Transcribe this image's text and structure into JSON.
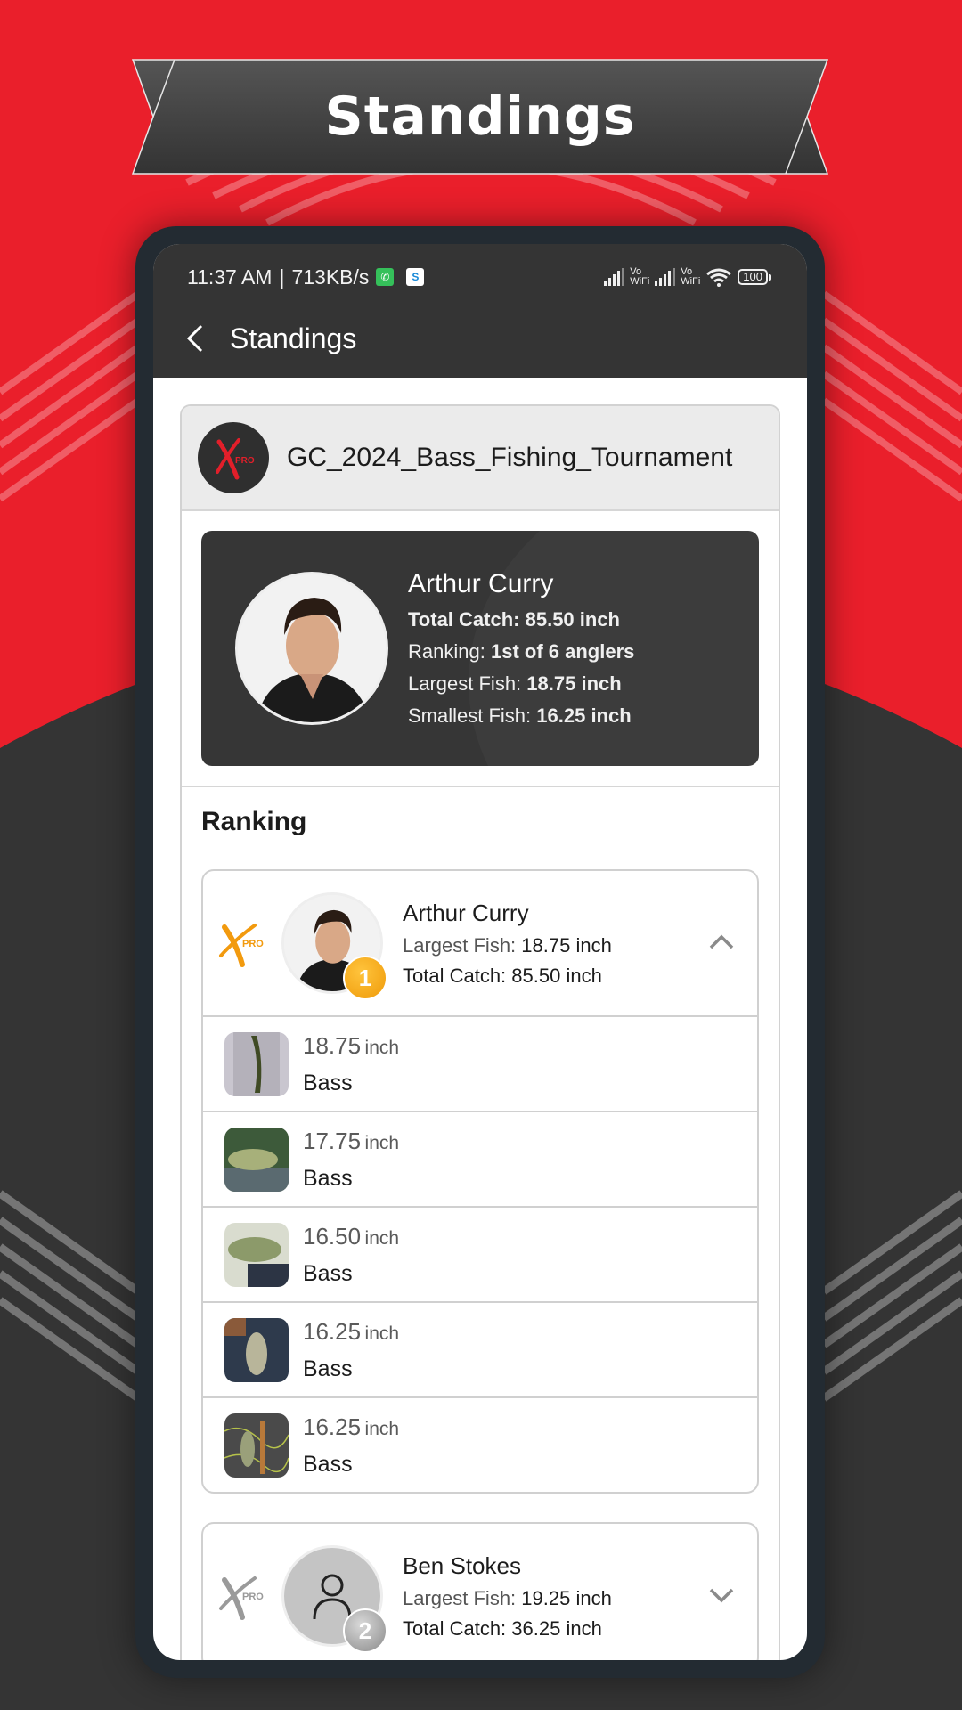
{
  "banner": {
    "title": "Standings"
  },
  "status_bar": {
    "time": "11:37 AM",
    "speed": "713KB/s",
    "separator": "|",
    "notif_icons": [
      "whatsapp-icon",
      "skype-icon"
    ],
    "vowifi_label_1": "Vo",
    "vowifi_label_2": "WiFi",
    "battery": "100"
  },
  "app_bar": {
    "title": "Standings",
    "back_icon": "chevron-left-icon"
  },
  "tournament": {
    "name": "GC_2024_Bass_Fishing_Tournament",
    "logo_text": "PRO"
  },
  "profile": {
    "name": "Arthur Curry",
    "total_catch_label": "Total Catch:",
    "total_catch_value": "85.50 inch",
    "ranking_label": "Ranking:",
    "ranking_value": "1st of 6 anglers",
    "largest_label": "Largest Fish:",
    "largest_value": "18.75 inch",
    "smallest_label": "Smallest Fish:",
    "smallest_value": "16.25 inch"
  },
  "ranking": {
    "title": "Ranking",
    "anglers": [
      {
        "name": "Arthur Curry",
        "rank": "1",
        "largest_label": "Largest Fish:",
        "largest_value": "18.75 inch",
        "total_label": "Total Catch:",
        "total_value": "85.50 inch",
        "expanded": true,
        "logo_color": "#f29a0e",
        "catches": [
          {
            "length": "18.75",
            "unit": "inch",
            "species": "Bass"
          },
          {
            "length": "17.75",
            "unit": "inch",
            "species": "Bass"
          },
          {
            "length": "16.50",
            "unit": "inch",
            "species": "Bass"
          },
          {
            "length": "16.25",
            "unit": "inch",
            "species": "Bass"
          },
          {
            "length": "16.25",
            "unit": "inch",
            "species": "Bass"
          }
        ]
      },
      {
        "name": "Ben Stokes",
        "rank": "2",
        "largest_label": "Largest Fish:",
        "largest_value": "19.25 inch",
        "total_label": "Total Catch:",
        "total_value": "36.25 inch",
        "expanded": false,
        "logo_color": "#9a9a9a"
      }
    ]
  },
  "colors": {
    "brand_red": "#ea1f2b",
    "dark": "#343434",
    "gold": "#f29a0e",
    "silver": "#a0a0a0"
  }
}
